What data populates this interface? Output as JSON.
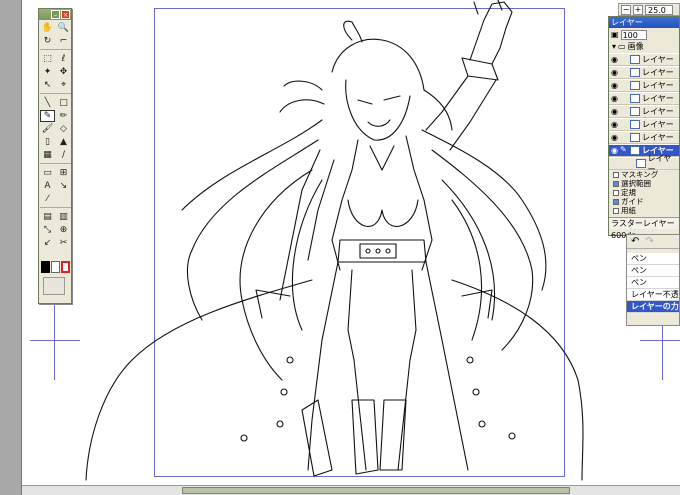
{
  "toolbox": {
    "tools": [
      {
        "name": "hand-tool-icon",
        "glyph": "✋"
      },
      {
        "name": "zoom-tool-icon",
        "glyph": "🔍"
      },
      {
        "name": "rotate-tool-icon",
        "glyph": "↻"
      },
      {
        "name": "eyedropper-tool-icon",
        "glyph": "⌐"
      },
      {
        "name": "rect-select-icon",
        "glyph": "⬚"
      },
      {
        "name": "lasso-select-icon",
        "glyph": "ℓ"
      },
      {
        "name": "magic-wand-icon",
        "glyph": "✦"
      },
      {
        "name": "move-tool-icon",
        "glyph": "✥"
      },
      {
        "name": "select-pen-icon",
        "glyph": "↖"
      },
      {
        "name": "object-select-icon",
        "glyph": "⌖"
      },
      {
        "name": "line-tool-icon",
        "glyph": "╲"
      },
      {
        "name": "rect-shape-icon",
        "glyph": "□"
      },
      {
        "name": "pen-tool-icon",
        "glyph": "✎"
      },
      {
        "name": "pencil-tool-icon",
        "glyph": "✏"
      },
      {
        "name": "brush-tool-icon",
        "glyph": "🖌"
      },
      {
        "name": "eraser-tool-icon",
        "glyph": "◇"
      },
      {
        "name": "marker-tool-icon",
        "glyph": "▯"
      },
      {
        "name": "bucket-tool-icon",
        "glyph": "▲"
      },
      {
        "name": "gradient-tool-icon",
        "glyph": "▦"
      },
      {
        "name": "airbrush-tool-icon",
        "glyph": "∕"
      },
      {
        "name": "frame-tool-icon",
        "glyph": "▭"
      },
      {
        "name": "rule-tool-icon",
        "glyph": "⊞"
      },
      {
        "name": "text-tool-icon",
        "glyph": "A"
      },
      {
        "name": "balloon-tool-icon",
        "glyph": "↘"
      },
      {
        "name": "dropper-tool-icon",
        "glyph": "⁄"
      },
      {
        "name": "spacer-icon",
        "glyph": ""
      },
      {
        "name": "tone-tool-icon",
        "glyph": "▤"
      },
      {
        "name": "tone-eraser-icon",
        "glyph": "▥"
      },
      {
        "name": "line-fix-icon",
        "glyph": "⤡"
      },
      {
        "name": "magnify-line-icon",
        "glyph": "⊕"
      },
      {
        "name": "pen-line-icon",
        "glyph": "↙"
      },
      {
        "name": "line-width-icon",
        "glyph": "✂"
      }
    ],
    "colors": {
      "fg": "#000000",
      "bg": "#ffffff",
      "accent": "#e02020"
    }
  },
  "zoom": {
    "value": "25.0"
  },
  "layers": {
    "title": "レイヤー",
    "opacity": "100",
    "folder": "画像",
    "items": [
      {
        "label": "レイヤー",
        "selected": false,
        "child": false
      },
      {
        "label": "レイヤー",
        "selected": false,
        "child": false
      },
      {
        "label": "レイヤー",
        "selected": false,
        "child": false
      },
      {
        "label": "レイヤー",
        "selected": false,
        "child": false
      },
      {
        "label": "レイヤー",
        "selected": false,
        "child": false
      },
      {
        "label": "レイヤー",
        "selected": false,
        "child": false
      },
      {
        "label": "レイヤー",
        "selected": false,
        "child": false
      },
      {
        "label": "レイヤー",
        "selected": true,
        "child": false
      },
      {
        "label": "レイヤー",
        "selected": false,
        "child": true
      }
    ],
    "special": [
      "マスキング",
      "選択範囲",
      "定規",
      "ガイド",
      "用紙"
    ],
    "status": "ラスターレイヤー 600dp"
  },
  "history": {
    "items": [
      {
        "label": "ペン",
        "selected": false
      },
      {
        "label": "ペン",
        "selected": false
      },
      {
        "label": "ペン",
        "selected": false
      },
      {
        "label": "レイヤー不透明",
        "selected": false
      },
      {
        "label": "レイヤーの力",
        "selected": true
      }
    ]
  }
}
